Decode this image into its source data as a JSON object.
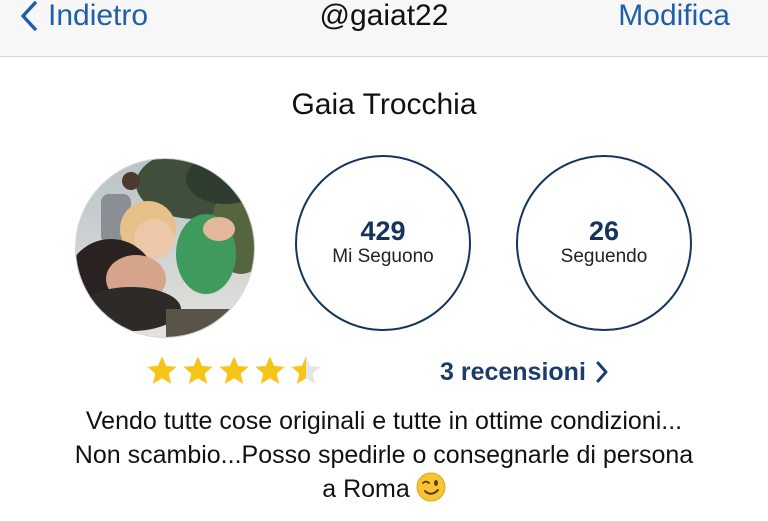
{
  "navbar": {
    "back_label": "Indietro",
    "title": "@gaiat22",
    "edit_label": "Modifica"
  },
  "profile": {
    "name": "Gaia Trocchia",
    "avatar_icon": "profile-photo"
  },
  "stats": {
    "followers_count": "429",
    "followers_label": "Mi Seguono",
    "following_count": "26",
    "following_label": "Seguendo"
  },
  "rating": {
    "value": 4.5,
    "max": 5,
    "star_color": "#f5c518",
    "reviews_label": "3 recensioni"
  },
  "bio": {
    "line1": "Vendo tutte cose originali e tutte in ottime condizioni...",
    "line2": "Non scambio...Posso spedirle o consegnarle di persona",
    "line3": "a Roma",
    "emoji_icon": "winking-face-emoji"
  },
  "colors": {
    "accent": "#1f5fa8",
    "circle_border": "#15345c",
    "navbar_bg": "#f7f7f7"
  }
}
